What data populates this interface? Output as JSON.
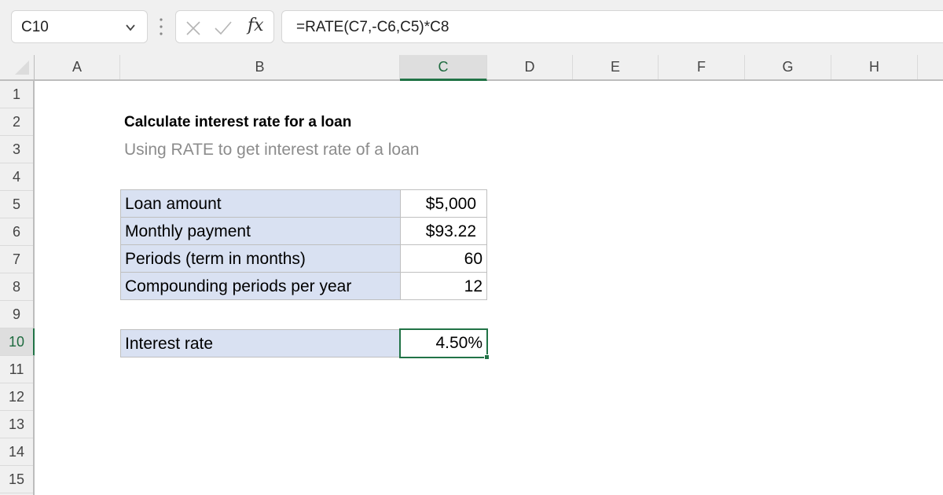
{
  "formula_bar": {
    "name_box": "C10",
    "formula": "=RATE(C7,-C6,C5)*C8",
    "icons": [
      "chevron-down-icon",
      "more-options-icon",
      "cancel-icon",
      "enter-icon",
      "insert-function-icon"
    ],
    "fx_label": "fx"
  },
  "columns": [
    "A",
    "B",
    "C",
    "D",
    "E",
    "F",
    "G",
    "H"
  ],
  "selected_column": "C",
  "rows": [
    "1",
    "2",
    "3",
    "4",
    "5",
    "6",
    "7",
    "8",
    "9",
    "10",
    "11",
    "12",
    "13",
    "14",
    "15"
  ],
  "selected_row": "10",
  "sheet": {
    "title": "Calculate interest rate for a loan",
    "subtitle": "Using RATE to get interest rate of a loan",
    "inputs": [
      {
        "label": "Loan amount",
        "value": "$5,000"
      },
      {
        "label": "Monthly payment",
        "value": "$93.22"
      },
      {
        "label": "Periods (term in months)",
        "value": "60"
      },
      {
        "label": "Compounding periods per year",
        "value": "12"
      }
    ],
    "result": {
      "label": "Interest rate",
      "value": "4.50%"
    }
  },
  "colors": {
    "accent": "#217346",
    "label_fill": "#d9e1f2",
    "subtitle_text": "#8c8c8c"
  }
}
